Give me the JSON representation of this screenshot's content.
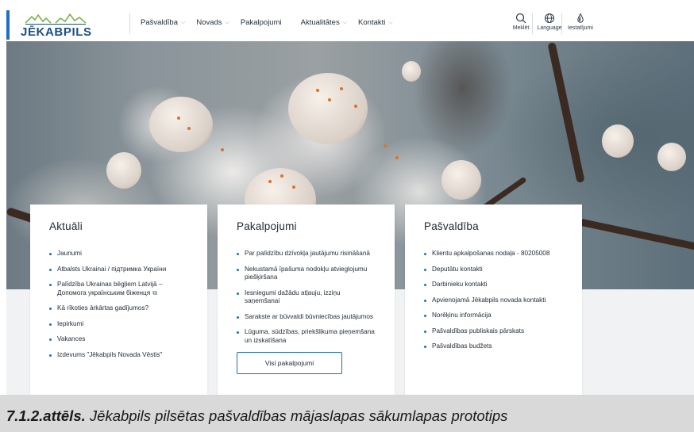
{
  "document": {
    "cropped_heading": "",
    "caption_number": "7.1.2.attēls.",
    "caption_text": " Jēkabpils pilsētas pašvaldības mājaslapas sākumlapas prototips"
  },
  "header": {
    "logo_text": "JĒKABPILS",
    "nav": [
      {
        "label": "Pašvaldība",
        "dropdown": true
      },
      {
        "label": "Novads",
        "dropdown": true
      },
      {
        "label": "Pakalpojumi",
        "dropdown": false
      },
      {
        "label": "Aktualitātes",
        "dropdown": true
      },
      {
        "label": "Kontakti",
        "dropdown": true
      }
    ],
    "tools": [
      {
        "label": "Meklēt",
        "icon": "search-icon"
      },
      {
        "label": "Language",
        "icon": "globe-icon"
      },
      {
        "label": "Iestatījumi",
        "icon": "contrast-drop-icon"
      }
    ]
  },
  "colors": {
    "accent": "#1f6fbf",
    "logo": "#1c4f86",
    "logo_wave": "#7ab648"
  },
  "cards": {
    "aktuali": {
      "title": "Aktuāli",
      "items": [
        "Jaunumi",
        "Atbalsts Ukrainai / підтримка України",
        "Palīdzība Ukrainas bēgļiem Latvijā – Допомога українським біженця",
        "Kā rīkoties ārkārtas gadījumos?",
        "Iepirkumi",
        "Vakances",
        "Izdevums \"Jēkabpils Novada Vēstis\""
      ]
    },
    "pakalpojumi": {
      "title": "Pakalpojumi",
      "items": [
        "Par palīdzību dzīvokļa jautājumu risināšanā",
        "Nekustamā īpašuma nodokļu atvieglojumu piešķiršana",
        "Iesniegumi dažādu atļauju, izziņu saņemšanai",
        "Sarakste ar būvvaldi būvniecības jautājumos",
        "Lūguma, sūdzības, priekšlikuma pieņemšana un izskatīšana"
      ],
      "button": "Visi pakalpojumi"
    },
    "pasvaldiba": {
      "title": "Pašvaldība",
      "items": [
        "Klientu apkalpošanas nodaļa - 80205008",
        "Deputātu kontakti",
        "Darbinieku kontakti",
        "Apvienojamā Jēkabpils novada kontakti",
        "Norēķinu informācija",
        "Pašvaldības publiskais pārskats",
        "Pašvaldības budžets"
      ]
    }
  }
}
